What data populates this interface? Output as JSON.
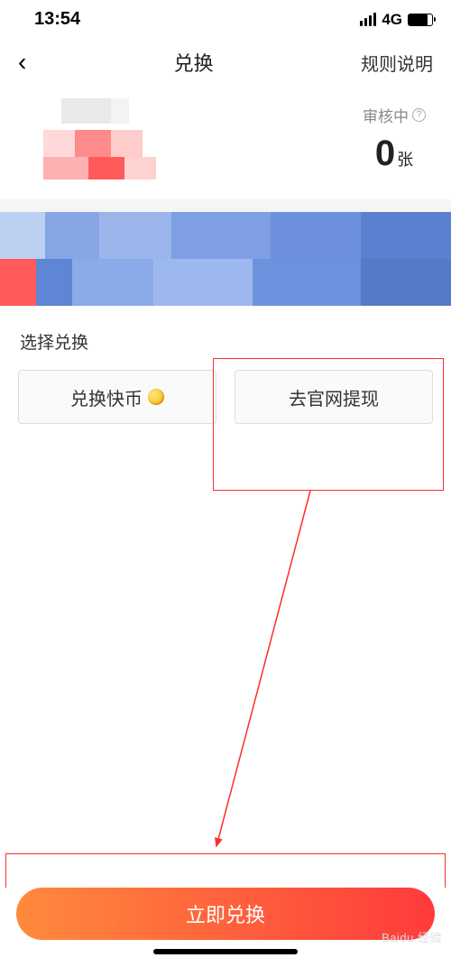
{
  "status": {
    "time": "13:54",
    "network": "4G"
  },
  "nav": {
    "title": "兑换",
    "right": "规则说明"
  },
  "balance": {
    "pending_label": "审核中",
    "count": "0",
    "unit": "张"
  },
  "exchange": {
    "section_title": "选择兑换",
    "option_coin": "兑换快币",
    "option_withdraw": "去官网提现"
  },
  "primary_action": "立即兑换",
  "watermark": "Baidu 经验"
}
